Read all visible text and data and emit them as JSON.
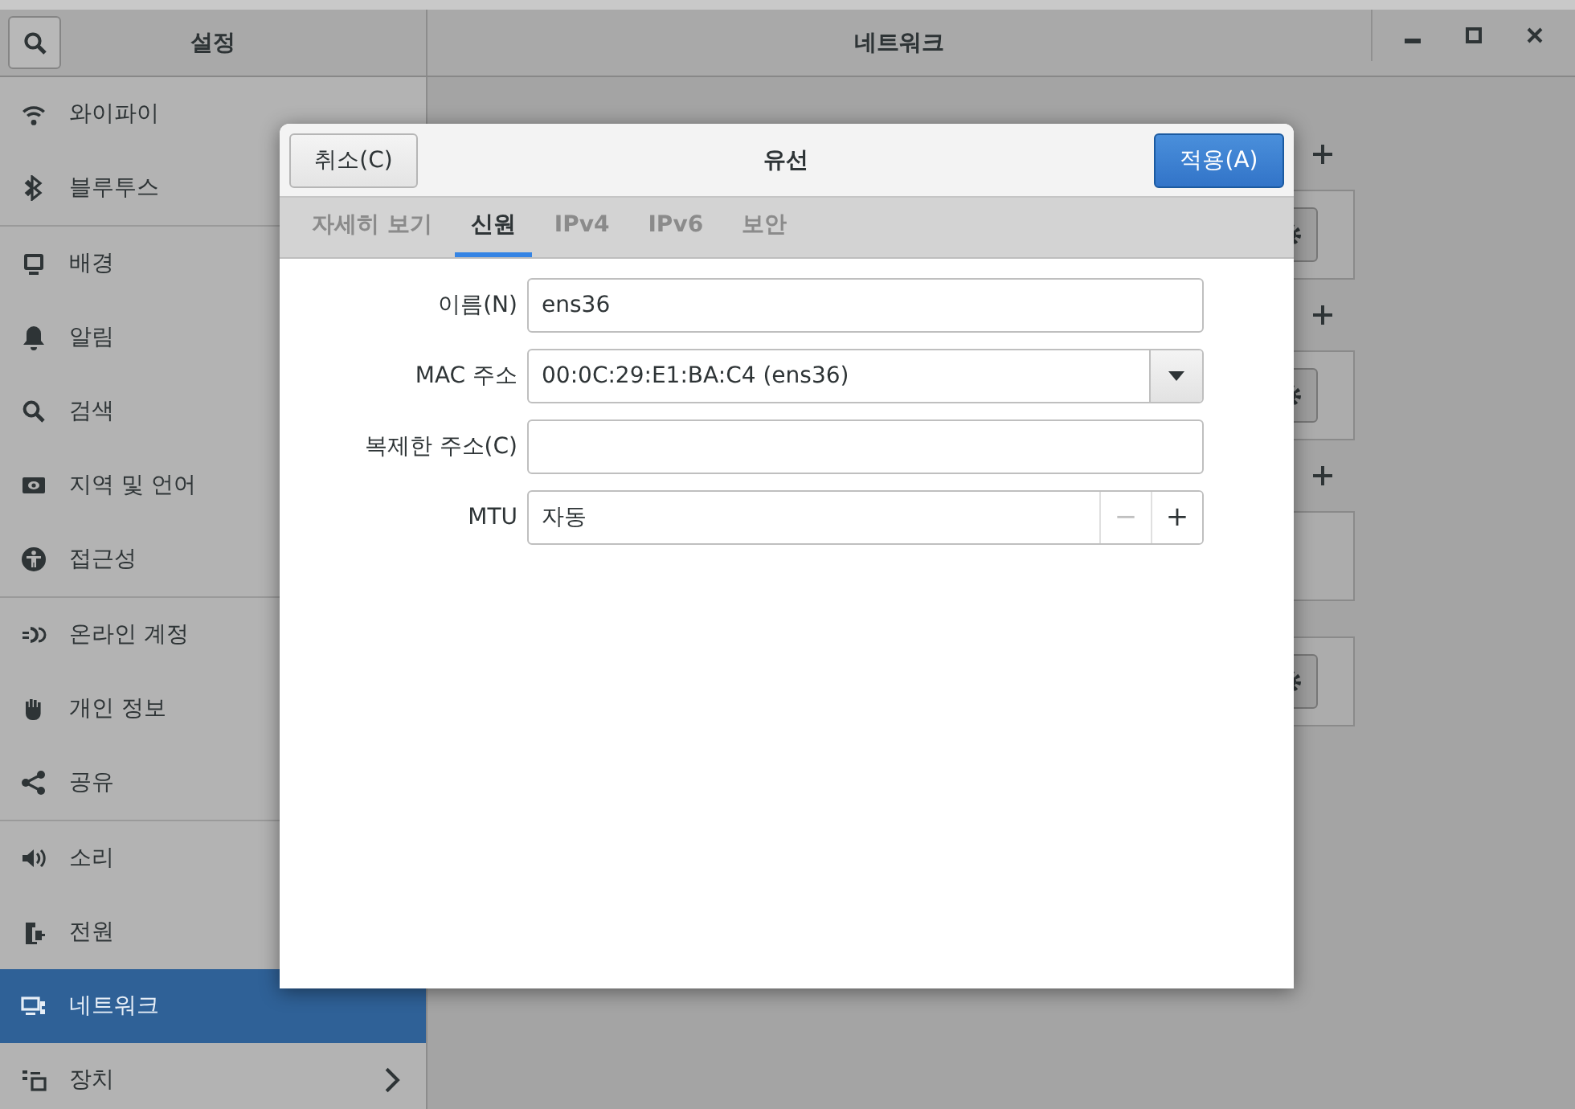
{
  "header": {
    "left_title": "설정",
    "title": "네트워크"
  },
  "sidebar": {
    "sections": [
      {
        "items": [
          {
            "label": "와이파이",
            "selected": false
          },
          {
            "label": "블루투스",
            "selected": false
          }
        ]
      },
      {
        "items": [
          {
            "label": "배경",
            "selected": false
          },
          {
            "label": "알림",
            "selected": false
          },
          {
            "label": "검색",
            "selected": false
          },
          {
            "label": "지역 및 언어",
            "selected": false
          },
          {
            "label": "접근성",
            "selected": false
          }
        ]
      },
      {
        "items": [
          {
            "label": "온라인 계정",
            "selected": false
          },
          {
            "label": "개인 정보",
            "selected": false
          },
          {
            "label": "공유",
            "selected": false
          }
        ]
      },
      {
        "items": [
          {
            "label": "소리",
            "selected": false
          },
          {
            "label": "전원",
            "selected": false
          },
          {
            "label": "네트워크",
            "selected": true
          },
          {
            "label": "장치",
            "selected": false,
            "submenu": true
          }
        ]
      }
    ]
  },
  "background_cards": [
    {
      "add": true,
      "gear": true
    },
    {
      "add": true,
      "gear": true
    },
    {
      "add": true,
      "gear": false
    },
    {
      "add": false,
      "gear": true
    }
  ],
  "dialog": {
    "title": "유선",
    "cancel": "취소(C)",
    "apply": "적용(A)",
    "tabs": [
      {
        "label": "자세히 보기",
        "selected": false
      },
      {
        "label": "신원",
        "selected": true
      },
      {
        "label": "IPv4",
        "selected": false
      },
      {
        "label": "IPv6",
        "selected": false
      },
      {
        "label": "보안",
        "selected": false
      }
    ],
    "fields": [
      {
        "kind": "text",
        "label": "이름(N)",
        "value": "ens36"
      },
      {
        "kind": "combo",
        "label": "MAC 주소",
        "value": "00:0C:29:E1:BA:C4 (ens36)"
      },
      {
        "kind": "text",
        "label": "복제한 주소(C)"
      },
      {
        "kind": "spin",
        "label": "MTU",
        "value": "자동",
        "minus": "−",
        "plus": "+"
      }
    ]
  }
}
